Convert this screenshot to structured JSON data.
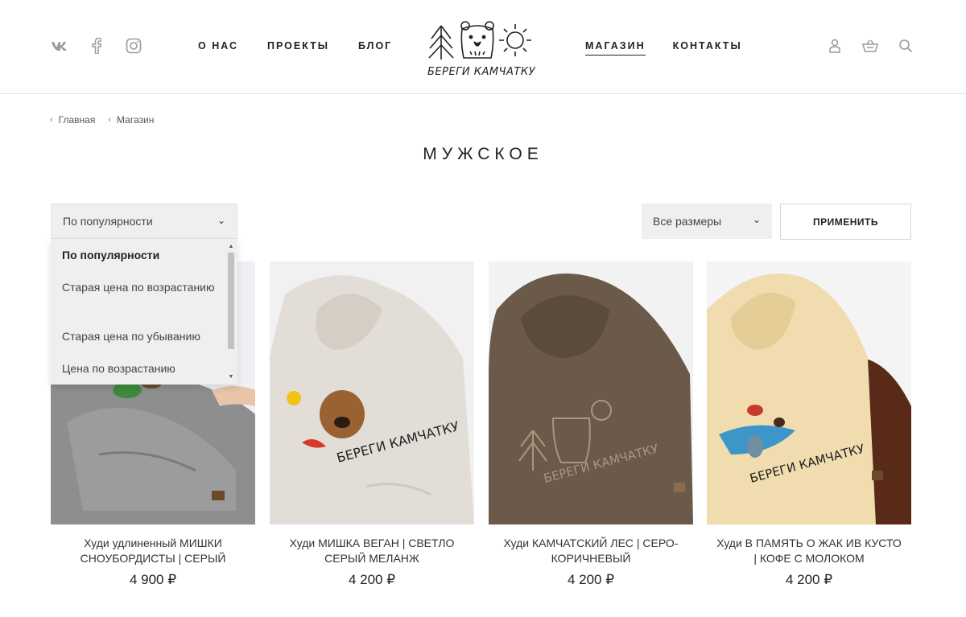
{
  "header": {
    "social": [
      {
        "icon": "vk-icon",
        "label": "VK"
      },
      {
        "icon": "facebook-icon",
        "label": "Facebook"
      },
      {
        "icon": "instagram-icon",
        "label": "Instagram"
      }
    ],
    "nav_left": [
      "О НАС",
      "ПРОЕКТЫ",
      "БЛОГ"
    ],
    "nav_right": [
      "МАГАЗИН",
      "КОНТАКТЫ"
    ],
    "active_nav": "МАГАЗИН",
    "logo_text": "БЕРЕГИ КАМЧАТКУ",
    "user_icons": [
      "user-icon",
      "cart-icon",
      "search-icon"
    ]
  },
  "breadcrumb": [
    "Главная",
    "Магазин"
  ],
  "page_title": "МУЖСКОЕ",
  "sort": {
    "selected": "По популярности",
    "options": [
      "По популярности",
      "Старая цена по возрастанию",
      "Старая цена по убыванию",
      "Цена по возрастанию"
    ]
  },
  "size_filter": {
    "selected": "Все размеры"
  },
  "apply_label": "ПРИМЕНИТЬ",
  "products": [
    {
      "name": "Худи удлиненный МИШКИ СНОУБОРДИСТЫ | СЕРЫЙ",
      "price": "4 900 ₽",
      "color": "#8d8e90"
    },
    {
      "name": "Худи МИШКА ВЕГАН | СВЕТЛО СЕРЫЙ МЕЛАНЖ",
      "price": "4 200 ₽",
      "color": "#e2ddd6"
    },
    {
      "name": "Худи КАМЧАТСКИЙ ЛЕС | СЕРО-КОРИЧНЕВЫЙ",
      "price": "4 200 ₽",
      "color": "#6b5a4a"
    },
    {
      "name": "Худи В ПАМЯТЬ О ЖАК ИВ КУСТО | КОФЕ С МОЛОКОМ",
      "price": "4 200 ₽",
      "color": "#f0dcae"
    }
  ]
}
